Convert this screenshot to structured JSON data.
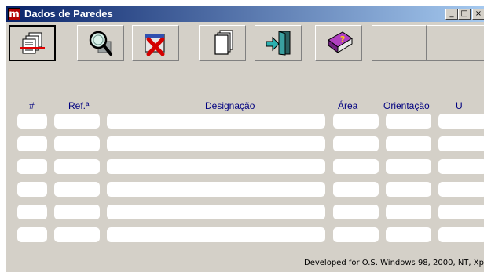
{
  "window": {
    "app_icon_letter": "m",
    "title": "Dados de Paredes",
    "minimize_label": "_",
    "maximize_label": "□",
    "close_label": "×"
  },
  "toolbar": {
    "buttons": [
      {
        "icon": "walls-list-icon",
        "active": true
      },
      {
        "icon": "search-icon"
      },
      {
        "icon": "delete-icon"
      },
      {
        "icon": "pages-icon"
      },
      {
        "icon": "exit-door-icon"
      },
      {
        "icon": "help-book-icon"
      }
    ]
  },
  "table": {
    "headers": {
      "number": "#",
      "reference": "Ref.ª",
      "designation": "Designação",
      "area": "Área",
      "orientation": "Orientação",
      "u": "U"
    },
    "rows": [
      {
        "number": "",
        "reference": "",
        "designation": "",
        "area": "",
        "orientation": "",
        "u": ""
      },
      {
        "number": "",
        "reference": "",
        "designation": "",
        "area": "",
        "orientation": "",
        "u": ""
      },
      {
        "number": "",
        "reference": "",
        "designation": "",
        "area": "",
        "orientation": "",
        "u": ""
      },
      {
        "number": "",
        "reference": "",
        "designation": "",
        "area": "",
        "orientation": "",
        "u": ""
      },
      {
        "number": "",
        "reference": "",
        "designation": "",
        "area": "",
        "orientation": "",
        "u": ""
      },
      {
        "number": "",
        "reference": "",
        "designation": "",
        "area": "",
        "orientation": "",
        "u": ""
      }
    ]
  },
  "footer": {
    "text": "Developed for O.S. Windows 98, 2000, NT, Xp"
  },
  "colors": {
    "titlebar_start": "#0a246a",
    "titlebar_end": "#a6caf0",
    "face": "#d4d0c8",
    "header_text": "#000080",
    "cell_bg": "#ffffff"
  }
}
